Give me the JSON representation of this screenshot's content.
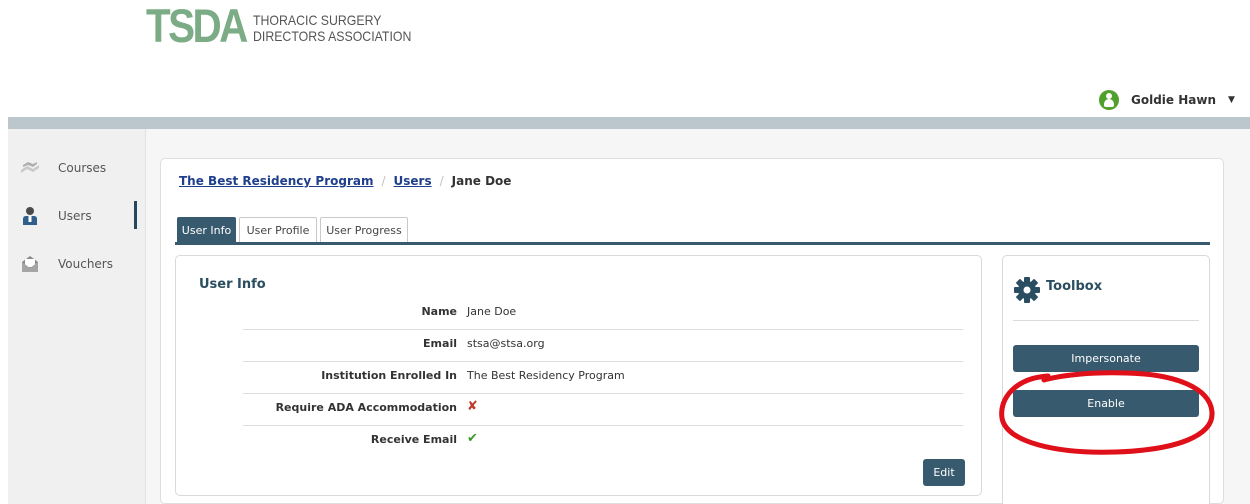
{
  "header": {
    "logo_mark": "TSDA",
    "logo_text_line1": "THORACIC SURGERY",
    "logo_text_line2": "DIRECTORS ASSOCIATION",
    "user_name": "Goldie Hawn",
    "user_menu_icon": "chevron-down-icon"
  },
  "sidebar": {
    "items": [
      {
        "label": "Courses",
        "icon": "courses-icon",
        "active": false
      },
      {
        "label": "Users",
        "icon": "user-icon",
        "active": true
      },
      {
        "label": "Vouchers",
        "icon": "voucher-envelope-icon",
        "active": false
      }
    ]
  },
  "breadcrumb": {
    "items": [
      "The Best Residency Program",
      "Users"
    ],
    "current": "Jane Doe",
    "separator": "/"
  },
  "tabs": [
    {
      "label": "User Info",
      "active": true
    },
    {
      "label": "User Profile",
      "active": false
    },
    {
      "label": "User Progress",
      "active": false
    }
  ],
  "user_info": {
    "title": "User Info",
    "rows": [
      {
        "label": "Name",
        "value": "Jane Doe"
      },
      {
        "label": "Email",
        "value": "stsa@stsa.org"
      },
      {
        "label": "Institution Enrolled In",
        "value": "The Best Residency Program"
      },
      {
        "label": "Require ADA Accommodation",
        "value": "✘"
      },
      {
        "label": "Receive Email",
        "value": "✔"
      }
    ],
    "edit_label": "Edit"
  },
  "toolbox": {
    "title": "Toolbox",
    "icon": "gear-icon",
    "impersonate_label": "Impersonate",
    "enable_label": "Enable"
  },
  "colors": {
    "brand_green": "#7bac85",
    "primary": "#385a6e",
    "link": "#1f3f8c",
    "annotation_red": "#e0101a"
  }
}
